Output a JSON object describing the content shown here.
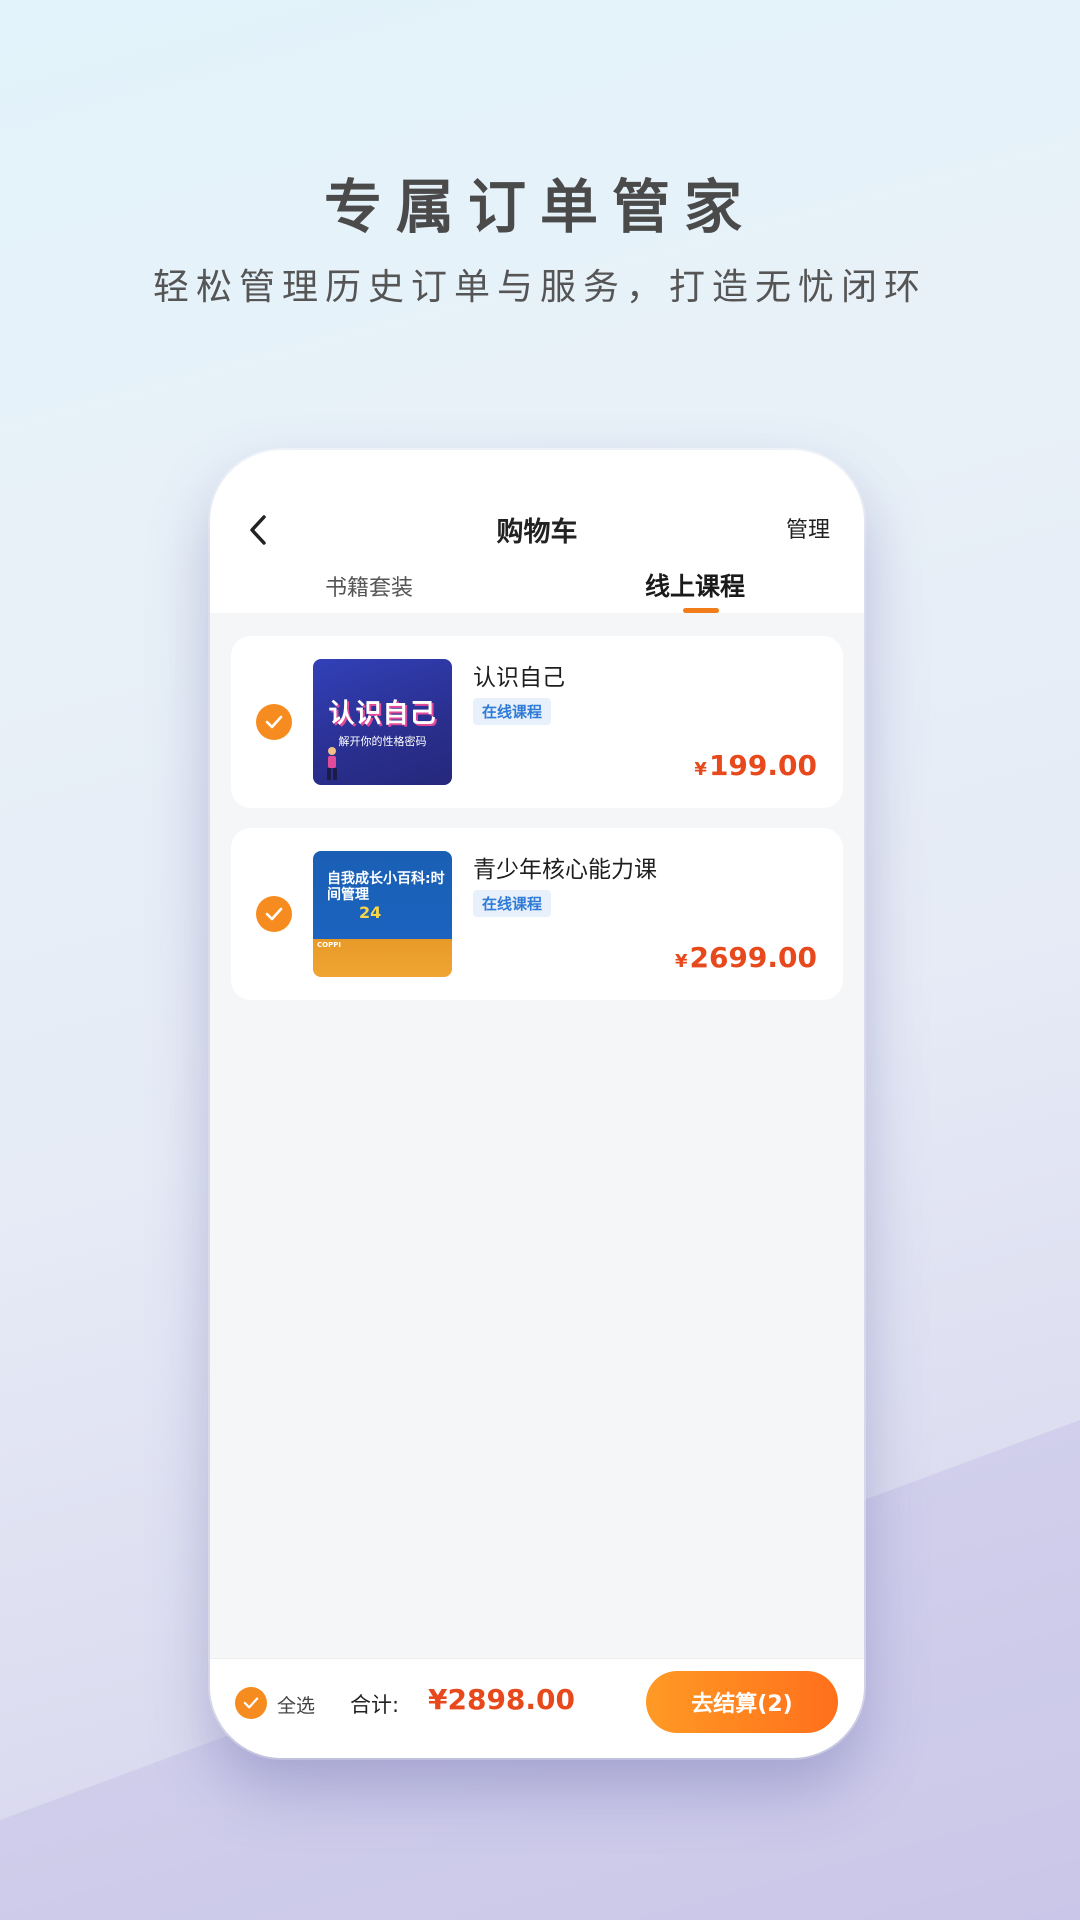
{
  "promo": {
    "headline": "专属订单管家",
    "subline": "轻松管理历史订单与服务，打造无忧闭环"
  },
  "header": {
    "title": "购物车",
    "manage_label": "管理",
    "back_icon": "chevron-left-icon"
  },
  "tabs": [
    {
      "label": "书籍套装",
      "active": false
    },
    {
      "label": "线上课程",
      "active": true
    }
  ],
  "cart_items": [
    {
      "name": "认识自己",
      "tag": "在线课程",
      "currency": "¥",
      "price": "199.00",
      "checked": true,
      "thumb_title": "认识自己",
      "thumb_subtitle": "解开你的性格密码"
    },
    {
      "name": "青少年核心能力课",
      "tag": "在线课程",
      "currency": "¥",
      "price": "2699.00",
      "checked": true,
      "thumb_title": "自我成长小百科:时间管理",
      "thumb_number": "24",
      "thumb_brand": "COPPI"
    }
  ],
  "footer": {
    "select_all_label": "全选",
    "total_label": "合计:",
    "total_value": "¥2898.00",
    "checkout_label": "去结算(2)"
  },
  "colors": {
    "accent_orange": "#f68b1f",
    "price_red": "#e8491c",
    "tag_blue": "#2f7bd5"
  }
}
